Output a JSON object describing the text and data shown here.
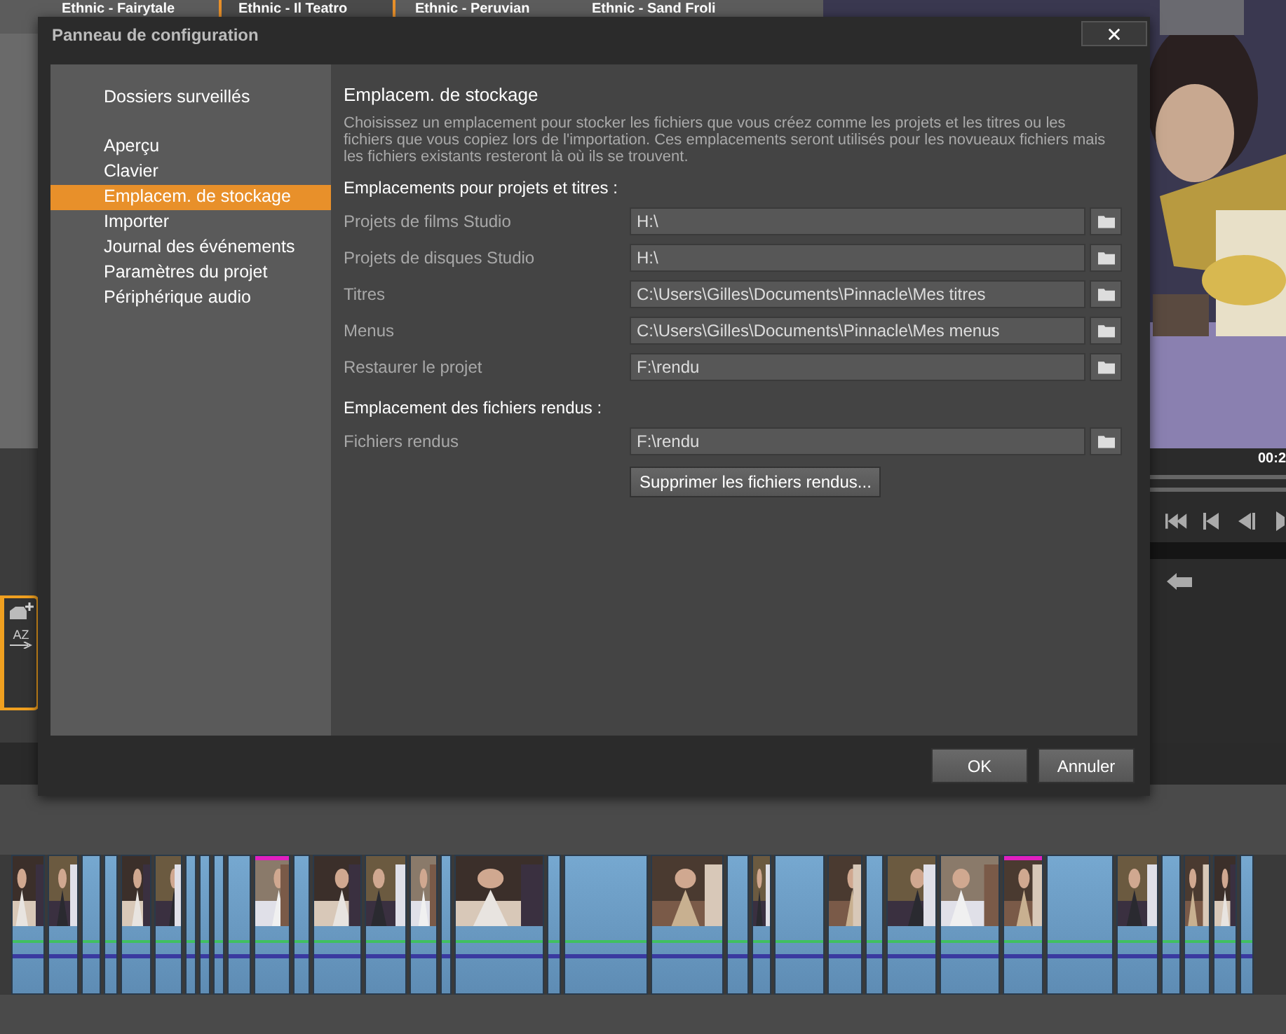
{
  "background": {
    "theme_tabs": [
      {
        "label": "Ethnic - Fairytale",
        "selected": false
      },
      {
        "label": "Ethnic - Il Teatro",
        "selected": true
      },
      {
        "label": "Ethnic - Peruvian",
        "selected": false
      },
      {
        "label": "Ethnic - Sand Froli",
        "selected": false
      }
    ],
    "timecode": "00:2",
    "sort_button": "AZ"
  },
  "dialog": {
    "title": "Panneau de configuration",
    "sidebar": {
      "groups": [
        [
          {
            "label": "Dossiers surveillés",
            "selected": false
          }
        ],
        [
          {
            "label": "Aperçu",
            "selected": false
          },
          {
            "label": "Clavier",
            "selected": false
          },
          {
            "label": "Emplacem. de stockage",
            "selected": true
          },
          {
            "label": "Importer",
            "selected": false
          },
          {
            "label": "Journal des événements",
            "selected": false
          },
          {
            "label": "Paramètres du projet",
            "selected": false
          },
          {
            "label": "Périphérique audio",
            "selected": false
          }
        ]
      ]
    },
    "page": {
      "title": "Emplacem. de stockage",
      "description": "Choisissez un emplacement pour stocker les fichiers que vous créez comme les projets et les titres ou les fichiers que vous copiez lors de l'importation. Ces emplacements seront utilisés pour les novueaux fichiers mais les fichiers existants resteront là où ils se trouvent.",
      "sections": [
        {
          "title": "Emplacements pour projets et titres :",
          "rows": [
            {
              "label": "Projets de films Studio",
              "value": "H:\\"
            },
            {
              "label": "Projets de disques Studio",
              "value": "H:\\"
            },
            {
              "label": "Titres",
              "value": "C:\\Users\\Gilles\\Documents\\Pinnacle\\Mes titres"
            },
            {
              "label": "Menus",
              "value": "C:\\Users\\Gilles\\Documents\\Pinnacle\\Mes menus"
            },
            {
              "label": "Restaurer le projet",
              "value": "F:\\rendu"
            }
          ]
        },
        {
          "title": "Emplacement des fichiers rendus :",
          "rows": [
            {
              "label": "Fichiers rendus",
              "value": "F:\\rendu"
            }
          ],
          "action": "Supprimer les fichiers rendus..."
        }
      ]
    },
    "buttons": [
      "OK",
      "Annuler"
    ]
  }
}
